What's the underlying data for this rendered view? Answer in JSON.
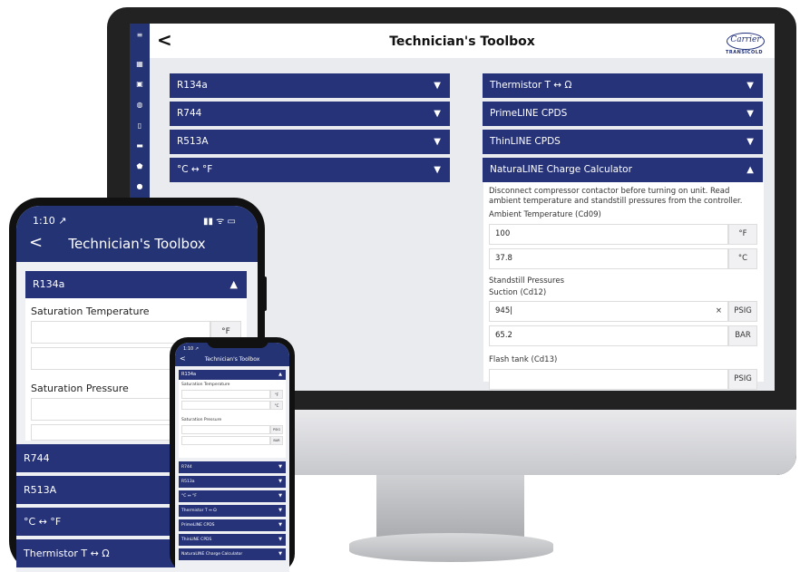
{
  "desktop": {
    "title": "Technician's Toolbox",
    "logo_text": "Carrier",
    "logo_sub": "TRANSICOLD",
    "left_accordions": [
      "R134a",
      "R744",
      "R513A",
      "°C ↔ °F"
    ],
    "right_accordions": [
      "Thermistor T ↔ Ω",
      "PrimeLINE CPDS",
      "ThinLINE CPDS"
    ],
    "open_accordion": "NaturaLINE Charge Calculator",
    "instructions": "Disconnect compressor contactor before turning on unit. Read ambient temperature and standstill pressures from the controller.",
    "ambient_label": "Ambient Temperature (Cd09)",
    "ambient_f": "100",
    "ambient_f_unit": "°F",
    "ambient_c": "37.8",
    "ambient_c_unit": "°C",
    "standstill_label": "Standstill Pressures",
    "suction_label": "Suction (Cd12)",
    "suction_psig": "945",
    "clear_icon": "×",
    "psig_unit": "PSIG",
    "suction_bar": "65.2",
    "bar_unit": "BAR",
    "flash_label": "Flash tank (Cd13)",
    "flash_unit": "PSIG"
  },
  "phone_large": {
    "time": "1:10 ↗",
    "status": "▮▮ ᯤ ▭",
    "title": "Technician's Toolbox",
    "open_accordion": "R134a",
    "sat_temp_label": "Saturation Temperature",
    "temp_unit": "°F",
    "sat_pressure_label": "Saturation Pressure",
    "accordions": [
      "R744",
      "R513A",
      "°C ↔ °F",
      "Thermistor T ↔ Ω"
    ]
  },
  "phone_small": {
    "time": "1:10 ↗",
    "title": "Technician's Toolbox",
    "open_accordion": "R134a",
    "sat_temp_label": "Saturation Temperature",
    "unit_f": "°F",
    "unit_c": "°C",
    "sat_pressure_label": "Saturation Pressure",
    "unit_psig": "PSIG",
    "unit_bar": "BAR",
    "accordions": [
      "R744",
      "R513a",
      "°C ↔ °F",
      "Thermistor T ↔ Ω",
      "PrimeLINE CPDS",
      "ThinLINE CPDS",
      "NaturaLINE Charge Calculator"
    ]
  }
}
